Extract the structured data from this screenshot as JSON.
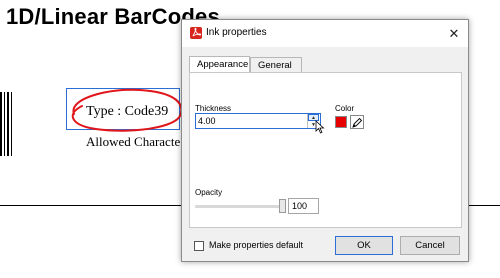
{
  "document": {
    "heading": "1D/Linear BarCodes",
    "annotation_text": "Type : Code39",
    "allowed_text": "Allowed Characte",
    "annotation_color": "#e0161b",
    "selection_color": "#2b6fd6"
  },
  "dialog": {
    "title": "Ink properties",
    "icon": "acrobat-icon",
    "close_label": "✕",
    "tabs": [
      {
        "label": "Appearance",
        "active": true
      },
      {
        "label": "General",
        "active": false
      }
    ],
    "thickness": {
      "label": "Thickness",
      "value": "4.00"
    },
    "color": {
      "label": "Color",
      "value": "#e60000"
    },
    "opacity": {
      "label": "Opacity",
      "value": "100"
    },
    "make_default": {
      "label": "Make properties default",
      "checked": false
    },
    "buttons": {
      "ok": "OK",
      "cancel": "Cancel"
    }
  }
}
